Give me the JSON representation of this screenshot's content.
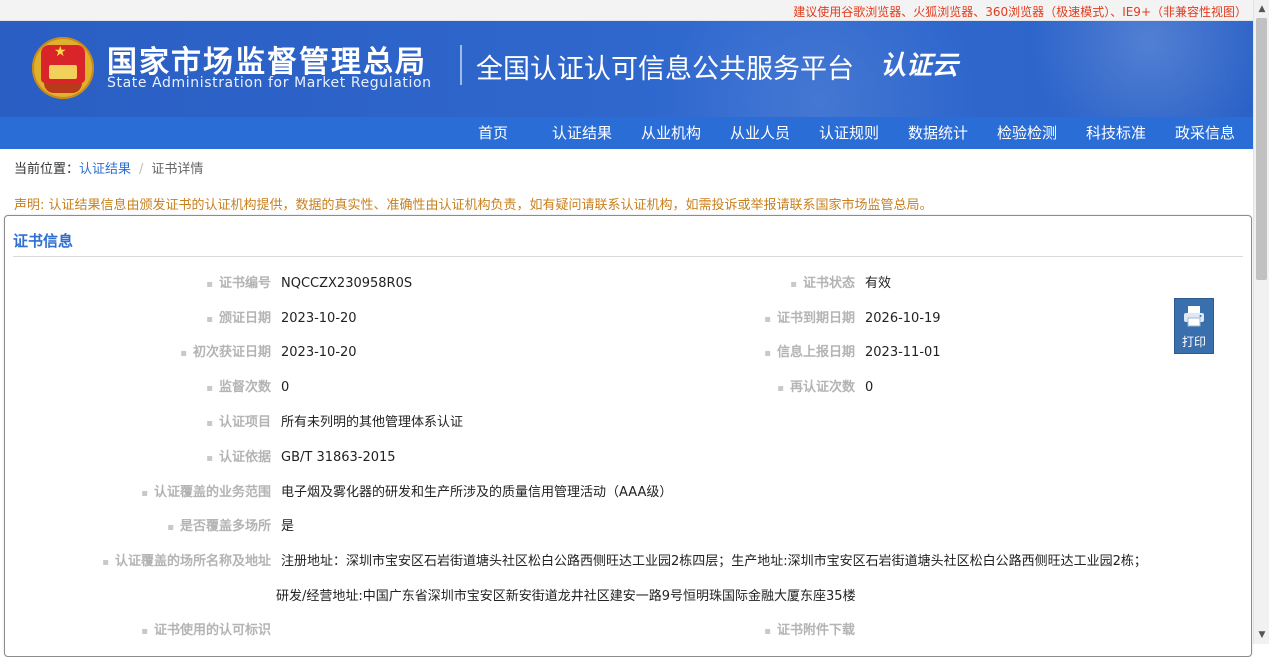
{
  "topbar": {
    "tip": "建议使用谷歌浏览器、火狐浏览器、360浏览器（极速模式）、IE9+（非兼容性视图）"
  },
  "header": {
    "org_cn": "国家市场监督管理总局",
    "org_en": "State Administration  for  Market Regulation",
    "platform": "全国认证认可信息公共服务平台",
    "brand": "认证云"
  },
  "nav": [
    "首页",
    "认证结果",
    "从业机构",
    "从业人员",
    "认证规则",
    "数据统计",
    "检验检测",
    "科技标准",
    "政采信息"
  ],
  "breadcrumb": {
    "label": "当前位置：",
    "link": "认证结果",
    "separator": "/",
    "current": "证书详情"
  },
  "notice": "声明: 认证结果信息由颁发证书的认证机构提供，数据的真实性、准确性由认证机构负责，如有疑问请联系认证机构，如需投诉或举报请联系国家市场监管总局。",
  "panel": {
    "title": "证书信息"
  },
  "fields": {
    "cert_no": {
      "label": "证书编号",
      "value": "NQCCZX230958R0S"
    },
    "status": {
      "label": "证书状态",
      "value": "有效"
    },
    "issue_date": {
      "label": "颁证日期",
      "value": "2023-10-20"
    },
    "expiry_date": {
      "label": "证书到期日期",
      "value": "2026-10-19"
    },
    "first_issue_date": {
      "label": "初次获证日期",
      "value": "2023-10-20"
    },
    "report_date": {
      "label": "信息上报日期",
      "value": "2023-11-01"
    },
    "supervision_count": {
      "label": "监督次数",
      "value": "0"
    },
    "recert_count": {
      "label": "再认证次数",
      "value": "0"
    },
    "project": {
      "label": "认证项目",
      "value": "所有未列明的其他管理体系认证"
    },
    "basis": {
      "label": "认证依据",
      "value": "GB/T 31863-2015"
    },
    "scope": {
      "label": "认证覆盖的业务范围",
      "value": "电子烟及雾化器的研发和生产所涉及的质量信用管理活动（AAA级）"
    },
    "multi_site": {
      "label": "是否覆盖多场所",
      "value": "是"
    },
    "sites": {
      "label": "认证覆盖的场所名称及地址",
      "line1": "注册地址：深圳市宝安区石岩街道塘头社区松白公路西侧旺达工业园2栋四层；生产地址:深圳市宝安区石岩街道塘头社区松白公路西侧旺达工业园2栋；",
      "line2": "研发/经营地址:中国广东省深圳市宝安区新安街道龙井社区建安一路9号恒明珠国际金融大厦东座35楼"
    },
    "mark": {
      "label": "证书使用的认可标识"
    },
    "attachment": {
      "label": "证书附件下载"
    }
  },
  "print": {
    "label": "打印"
  },
  "colors": {
    "header_bg": "#2b62c7",
    "nav_bg": "#2a6dd6",
    "link": "#2f6fd2",
    "notice": "#c8801e",
    "tip": "#e23b1c"
  }
}
